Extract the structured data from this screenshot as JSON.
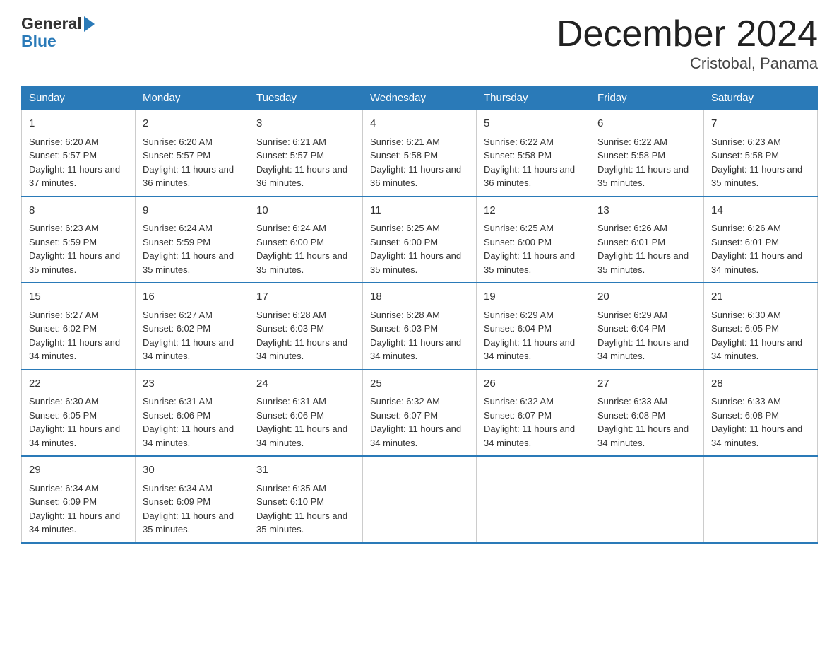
{
  "header": {
    "title": "December 2024",
    "subtitle": "Cristobal, Panama",
    "logo_general": "General",
    "logo_blue": "Blue"
  },
  "days_of_week": [
    "Sunday",
    "Monday",
    "Tuesday",
    "Wednesday",
    "Thursday",
    "Friday",
    "Saturday"
  ],
  "weeks": [
    [
      {
        "day": "1",
        "sunrise": "6:20 AM",
        "sunset": "5:57 PM",
        "daylight": "11 hours and 37 minutes."
      },
      {
        "day": "2",
        "sunrise": "6:20 AM",
        "sunset": "5:57 PM",
        "daylight": "11 hours and 36 minutes."
      },
      {
        "day": "3",
        "sunrise": "6:21 AM",
        "sunset": "5:57 PM",
        "daylight": "11 hours and 36 minutes."
      },
      {
        "day": "4",
        "sunrise": "6:21 AM",
        "sunset": "5:58 PM",
        "daylight": "11 hours and 36 minutes."
      },
      {
        "day": "5",
        "sunrise": "6:22 AM",
        "sunset": "5:58 PM",
        "daylight": "11 hours and 36 minutes."
      },
      {
        "day": "6",
        "sunrise": "6:22 AM",
        "sunset": "5:58 PM",
        "daylight": "11 hours and 35 minutes."
      },
      {
        "day": "7",
        "sunrise": "6:23 AM",
        "sunset": "5:58 PM",
        "daylight": "11 hours and 35 minutes."
      }
    ],
    [
      {
        "day": "8",
        "sunrise": "6:23 AM",
        "sunset": "5:59 PM",
        "daylight": "11 hours and 35 minutes."
      },
      {
        "day": "9",
        "sunrise": "6:24 AM",
        "sunset": "5:59 PM",
        "daylight": "11 hours and 35 minutes."
      },
      {
        "day": "10",
        "sunrise": "6:24 AM",
        "sunset": "6:00 PM",
        "daylight": "11 hours and 35 minutes."
      },
      {
        "day": "11",
        "sunrise": "6:25 AM",
        "sunset": "6:00 PM",
        "daylight": "11 hours and 35 minutes."
      },
      {
        "day": "12",
        "sunrise": "6:25 AM",
        "sunset": "6:00 PM",
        "daylight": "11 hours and 35 minutes."
      },
      {
        "day": "13",
        "sunrise": "6:26 AM",
        "sunset": "6:01 PM",
        "daylight": "11 hours and 35 minutes."
      },
      {
        "day": "14",
        "sunrise": "6:26 AM",
        "sunset": "6:01 PM",
        "daylight": "11 hours and 34 minutes."
      }
    ],
    [
      {
        "day": "15",
        "sunrise": "6:27 AM",
        "sunset": "6:02 PM",
        "daylight": "11 hours and 34 minutes."
      },
      {
        "day": "16",
        "sunrise": "6:27 AM",
        "sunset": "6:02 PM",
        "daylight": "11 hours and 34 minutes."
      },
      {
        "day": "17",
        "sunrise": "6:28 AM",
        "sunset": "6:03 PM",
        "daylight": "11 hours and 34 minutes."
      },
      {
        "day": "18",
        "sunrise": "6:28 AM",
        "sunset": "6:03 PM",
        "daylight": "11 hours and 34 minutes."
      },
      {
        "day": "19",
        "sunrise": "6:29 AM",
        "sunset": "6:04 PM",
        "daylight": "11 hours and 34 minutes."
      },
      {
        "day": "20",
        "sunrise": "6:29 AM",
        "sunset": "6:04 PM",
        "daylight": "11 hours and 34 minutes."
      },
      {
        "day": "21",
        "sunrise": "6:30 AM",
        "sunset": "6:05 PM",
        "daylight": "11 hours and 34 minutes."
      }
    ],
    [
      {
        "day": "22",
        "sunrise": "6:30 AM",
        "sunset": "6:05 PM",
        "daylight": "11 hours and 34 minutes."
      },
      {
        "day": "23",
        "sunrise": "6:31 AM",
        "sunset": "6:06 PM",
        "daylight": "11 hours and 34 minutes."
      },
      {
        "day": "24",
        "sunrise": "6:31 AM",
        "sunset": "6:06 PM",
        "daylight": "11 hours and 34 minutes."
      },
      {
        "day": "25",
        "sunrise": "6:32 AM",
        "sunset": "6:07 PM",
        "daylight": "11 hours and 34 minutes."
      },
      {
        "day": "26",
        "sunrise": "6:32 AM",
        "sunset": "6:07 PM",
        "daylight": "11 hours and 34 minutes."
      },
      {
        "day": "27",
        "sunrise": "6:33 AM",
        "sunset": "6:08 PM",
        "daylight": "11 hours and 34 minutes."
      },
      {
        "day": "28",
        "sunrise": "6:33 AM",
        "sunset": "6:08 PM",
        "daylight": "11 hours and 34 minutes."
      }
    ],
    [
      {
        "day": "29",
        "sunrise": "6:34 AM",
        "sunset": "6:09 PM",
        "daylight": "11 hours and 34 minutes."
      },
      {
        "day": "30",
        "sunrise": "6:34 AM",
        "sunset": "6:09 PM",
        "daylight": "11 hours and 35 minutes."
      },
      {
        "day": "31",
        "sunrise": "6:35 AM",
        "sunset": "6:10 PM",
        "daylight": "11 hours and 35 minutes."
      },
      {
        "day": "",
        "sunrise": "",
        "sunset": "",
        "daylight": ""
      },
      {
        "day": "",
        "sunrise": "",
        "sunset": "",
        "daylight": ""
      },
      {
        "day": "",
        "sunrise": "",
        "sunset": "",
        "daylight": ""
      },
      {
        "day": "",
        "sunrise": "",
        "sunset": "",
        "daylight": ""
      }
    ]
  ],
  "labels": {
    "sunrise_prefix": "Sunrise: ",
    "sunset_prefix": "Sunset: ",
    "daylight_prefix": "Daylight: "
  }
}
